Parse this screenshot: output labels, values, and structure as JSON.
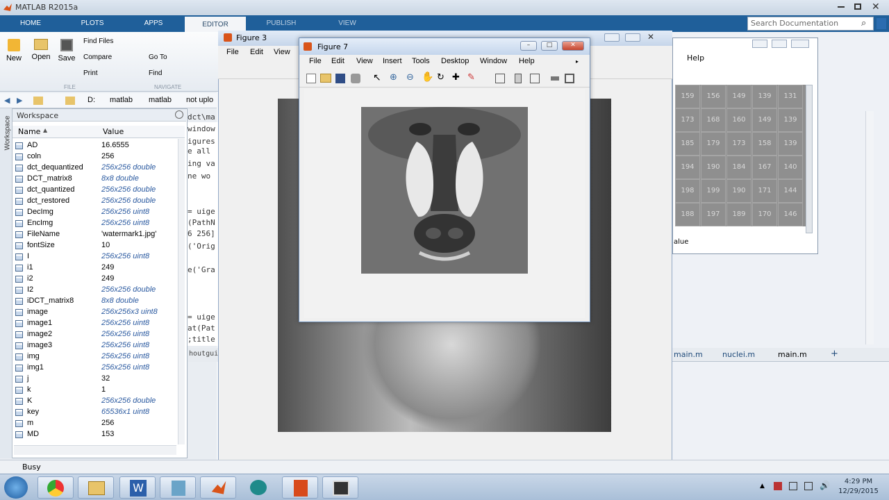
{
  "app": {
    "title": "MATLAB R2015a"
  },
  "tabs": [
    {
      "label": "HOME"
    },
    {
      "label": "PLOTS"
    },
    {
      "label": "APPS"
    },
    {
      "label": "EDITOR"
    },
    {
      "label": "PUBLISH"
    },
    {
      "label": "VIEW"
    }
  ],
  "search": {
    "placeholder": "Search Documentation"
  },
  "toolstrip": {
    "new": "New",
    "open": "Open",
    "save": "Save",
    "find_files": "Find Files",
    "compare": "Compare",
    "print": "Print",
    "go_to": "Go To",
    "find": "Find",
    "section_file": "FILE",
    "section_navigate": "NAVIGATE"
  },
  "address": {
    "drive": "D:",
    "p1": "matlab",
    "p2": "matlab",
    "p3": "not uplo"
  },
  "workspace": {
    "title": "Workspace",
    "vertical_label": "Workspace",
    "col_name": "Name",
    "col_value": "Value",
    "rows": [
      {
        "name": "AD",
        "value": "16.6555",
        "italic": false
      },
      {
        "name": "coln",
        "value": "256",
        "italic": false
      },
      {
        "name": "dct_dequantized",
        "value": "256x256 double",
        "italic": true
      },
      {
        "name": "DCT_matrix8",
        "value": "8x8 double",
        "italic": true
      },
      {
        "name": "dct_quantized",
        "value": "256x256 double",
        "italic": true
      },
      {
        "name": "dct_restored",
        "value": "256x256 double",
        "italic": true
      },
      {
        "name": "DecImg",
        "value": "256x256 uint8",
        "italic": true
      },
      {
        "name": "EncImg",
        "value": "256x256 uint8",
        "italic": true
      },
      {
        "name": "FileName",
        "value": "'watermark1.jpg'",
        "italic": false
      },
      {
        "name": "fontSize",
        "value": "10",
        "italic": false
      },
      {
        "name": "I",
        "value": "256x256 uint8",
        "italic": true
      },
      {
        "name": "i1",
        "value": "249",
        "italic": false
      },
      {
        "name": "i2",
        "value": "249",
        "italic": false
      },
      {
        "name": "I2",
        "value": "256x256 double",
        "italic": true
      },
      {
        "name": "iDCT_matrix8",
        "value": "8x8 double",
        "italic": true
      },
      {
        "name": "image",
        "value": "256x256x3 uint8",
        "italic": true
      },
      {
        "name": "image1",
        "value": "256x256 uint8",
        "italic": true
      },
      {
        "name": "image2",
        "value": "256x256 uint8",
        "italic": true
      },
      {
        "name": "image3",
        "value": "256x256 uint8",
        "italic": true
      },
      {
        "name": "img",
        "value": "256x256 uint8",
        "italic": true
      },
      {
        "name": "img1",
        "value": "256x256 uint8",
        "italic": true
      },
      {
        "name": "j",
        "value": "32",
        "italic": false
      },
      {
        "name": "k",
        "value": "1",
        "italic": false
      },
      {
        "name": "K",
        "value": "256x256 double",
        "italic": true
      },
      {
        "name": "key",
        "value": "65536x1 uint8",
        "italic": true
      },
      {
        "name": "m",
        "value": "256",
        "italic": false
      },
      {
        "name": "MD",
        "value": "153",
        "italic": false
      }
    ]
  },
  "status": {
    "text": "Busy"
  },
  "code_lines": [
    "window",
    "igures",
    "e all",
    "ing va",
    "ne wo",
    "= uige",
    "(PathN",
    "6 256]",
    "('Orig",
    "e('Gra",
    "= uige",
    "at(Pat",
    ";title"
  ],
  "editor_path": "dct\\ma",
  "bottom_tab": "houtgui",
  "figure3": {
    "title": "Figure 3",
    "menu": [
      "File",
      "Edit",
      "View"
    ]
  },
  "figure7": {
    "title": "Figure 7",
    "menu": [
      "File",
      "Edit",
      "View",
      "Insert",
      "Tools",
      "Desktop",
      "Window",
      "Help"
    ]
  },
  "variables": {
    "help": "Help",
    "value_label": "alue",
    "grid": [
      [
        "159",
        "156",
        "149",
        "139",
        "131"
      ],
      [
        "173",
        "168",
        "160",
        "149",
        "139"
      ],
      [
        "185",
        "179",
        "173",
        "158",
        "139"
      ],
      [
        "194",
        "190",
        "184",
        "167",
        "140"
      ],
      [
        "198",
        "199",
        "190",
        "171",
        "144"
      ],
      [
        "188",
        "197",
        "189",
        "170",
        "146"
      ]
    ]
  },
  "editor_tabs": [
    {
      "label": "main.m",
      "active": false
    },
    {
      "label": "nuclei.m",
      "active": false
    },
    {
      "label": "main.m",
      "active": true
    },
    {
      "label": "+",
      "active": false
    }
  ],
  "taskbar": {
    "time": "4:29 PM",
    "date": "12/29/2015"
  },
  "colors": {
    "tabbar": "#1f5f9a",
    "titlebar": "#c9d5e3",
    "close": "#c5442d"
  }
}
